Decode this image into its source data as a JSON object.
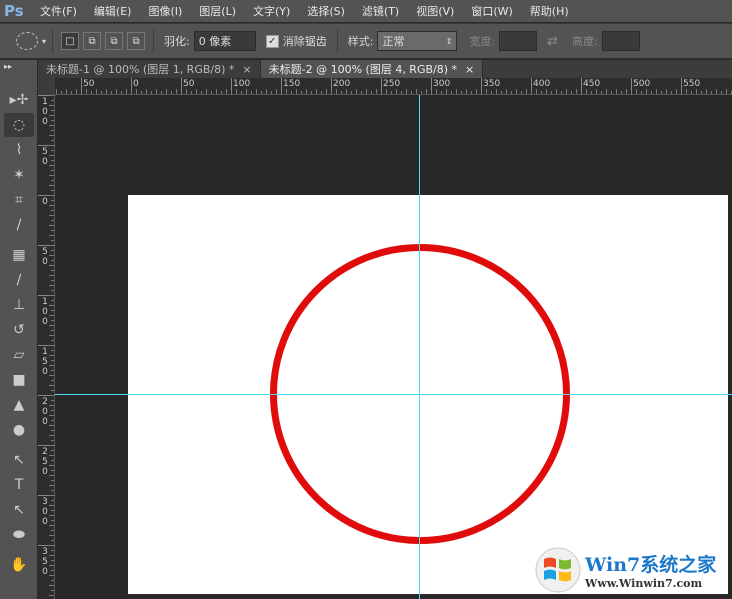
{
  "app": {
    "logo": "Ps"
  },
  "menu": [
    "文件(F)",
    "编辑(E)",
    "图像(I)",
    "图层(L)",
    "文字(Y)",
    "选择(S)",
    "滤镜(T)",
    "视图(V)",
    "窗口(W)",
    "帮助(H)"
  ],
  "options": {
    "feather_label": "羽化:",
    "feather_value": "0 像素",
    "antialias_label": "消除锯齿",
    "antialias_checked": true,
    "style_label": "样式:",
    "style_value": "正常",
    "width_label": "宽度:",
    "height_label": "高度:"
  },
  "tabs": [
    {
      "label": "未标题-1 @ 100% (图层 1, RGB/8) *",
      "active": false
    },
    {
      "label": "未标题-2 @ 100% (图层 4, RGB/8) *",
      "active": true
    }
  ],
  "hruler": [
    "50",
    "0",
    "50",
    "100",
    "150",
    "200",
    "250",
    "300",
    "350",
    "400",
    "450",
    "500",
    "550"
  ],
  "vruler": [
    "100",
    "50",
    "0",
    "50",
    "100",
    "150",
    "200",
    "250",
    "300",
    "350"
  ],
  "tools": [
    "move",
    "elliptical-marquee",
    "polygonal-lasso",
    "magic-wand",
    "crop",
    "eyedropper",
    "spot-healing",
    "brush",
    "clone-stamp",
    "history-brush",
    "eraser",
    "gradient",
    "blur",
    "dodge",
    "path-selection",
    "type",
    "direct-selection",
    "ellipse",
    "hand"
  ],
  "colors": {
    "circle_stroke": "#e00c0c",
    "guide": "#4fd8ef"
  },
  "watermark": {
    "brand": "Win7系统之家",
    "url": "Www.Winwin7.com"
  }
}
